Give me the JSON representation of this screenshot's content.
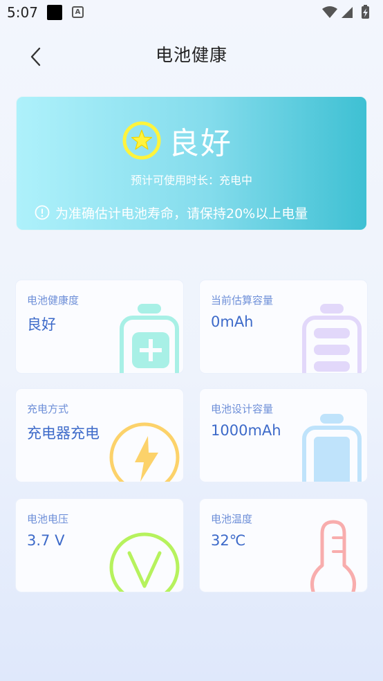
{
  "status_bar": {
    "time": "5:07"
  },
  "header": {
    "title": "电池健康"
  },
  "hero": {
    "status": "良好",
    "subtitle": "预计可使用时长：充电中",
    "tip": "为准确估计电池寿命，请保持20%以上电量"
  },
  "cards": [
    {
      "label": "电池健康度",
      "value": "良好",
      "icon": "battery-plus-icon",
      "color": "#a8f0e6"
    },
    {
      "label": "当前估算容量",
      "value": "0mAh",
      "icon": "battery-level-icon",
      "color": "#e2d8fa"
    },
    {
      "label": "充电方式",
      "value": "充电器充电",
      "icon": "lightning-icon",
      "color": "#fcd26a"
    },
    {
      "label": "电池设计容量",
      "value": "1000mAh",
      "icon": "battery-full-icon",
      "color": "#bfe3fb"
    },
    {
      "label": "电池电压",
      "value": "3.7 V",
      "icon": "voltage-icon",
      "color": "#b6f25d"
    },
    {
      "label": "电池温度",
      "value": "32℃",
      "icon": "thermometer-icon",
      "color": "#f8adad"
    }
  ]
}
